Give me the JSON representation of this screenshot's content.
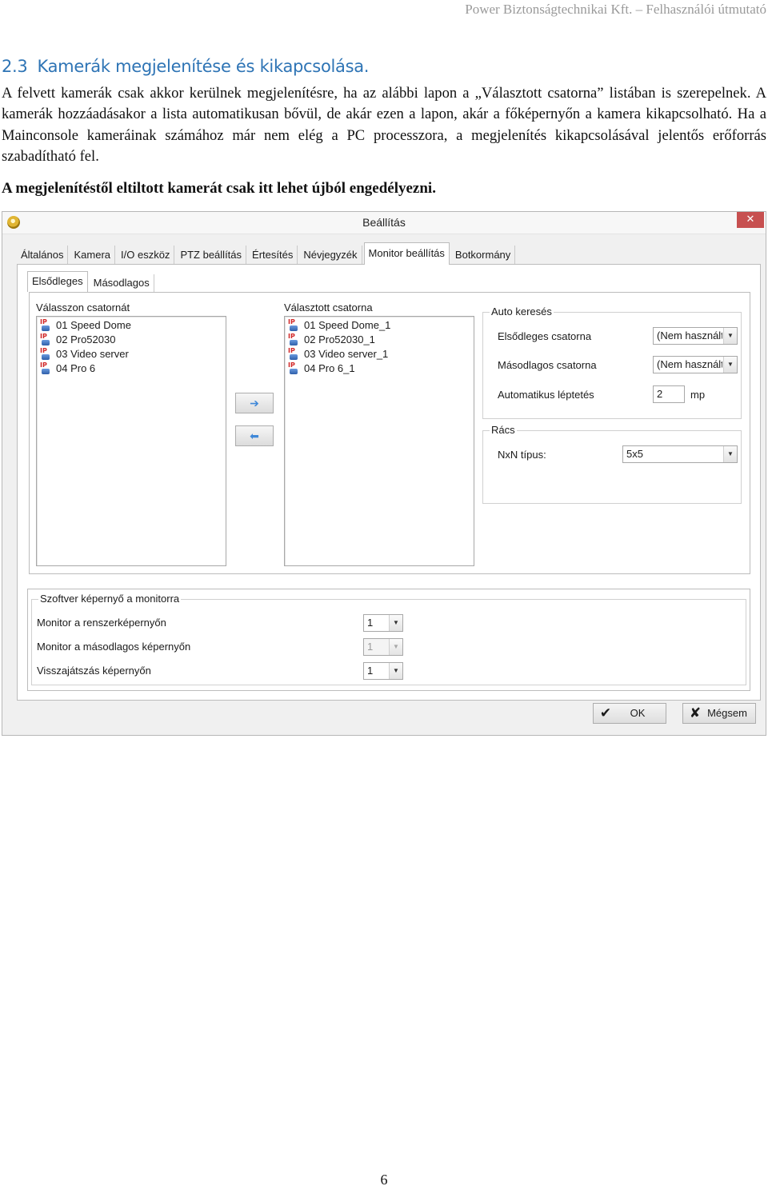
{
  "header": {
    "running_title": "Power Biztonságtechnikai Kft. – Felhasználói útmutató"
  },
  "section": {
    "number": "2.3",
    "title": "Kamerák megjelenítése és kikapcsolása.",
    "paragraph": "A felvett kamerák csak akkor kerülnek megjelenítésre, ha az alábbi lapon a „Választott csatorna” listában is szerepelnek. A kamerák hozzáadásakor a lista automatikusan bővül, de akár ezen a lapon, akár a főképernyőn a kamera kikapcsolható. Ha a Mainconsole kameráinak számához már nem elég a PC processzora, a megjelenítés kikapcsolásával jelentős erőforrás szabadítható fel.",
    "bold_note": "A megjelenítéstől eltiltott kamerát csak itt lehet újból engedélyezni."
  },
  "dialog": {
    "title": "Beállítás",
    "close_glyph": "✕",
    "tabs": [
      "Általános",
      "Kamera",
      "I/O eszköz",
      "PTZ beállítás",
      "Értesítés",
      "Névjegyzék",
      "Monitor beállítás",
      "Botkormány"
    ],
    "active_tab": "Monitor beállítás",
    "subtabs": [
      "Elsődleges",
      "Másodlagos"
    ],
    "active_subtab": "Elsődleges",
    "available_label": "Válasszon csatornát",
    "available_channels": [
      "01 Speed Dome",
      "02 Pro52030",
      "03 Video server",
      "04 Pro 6"
    ],
    "selected_label": "Választott csatorna",
    "selected_channels": [
      "01 Speed Dome_1",
      "02 Pro52030_1",
      "03 Video server_1",
      "04 Pro 6_1"
    ],
    "channel_icon_text": "IP",
    "add_button_glyph": "➔",
    "remove_button_glyph": "⬅",
    "auto_search": {
      "title": "Auto keresés",
      "primary_label": "Elsődleges csatorna",
      "primary_value": "(Nem használt)",
      "secondary_label": "Másodlagos csatorna",
      "secondary_value": "(Nem használt)",
      "auto_step_label": "Automatikus léptetés",
      "auto_step_value": "2",
      "auto_step_unit": "mp"
    },
    "grid": {
      "title": "Rács",
      "nxn_label": "NxN típus:",
      "nxn_value": "5x5"
    },
    "software_screen": {
      "title": "Szoftver képernyő a monitorra",
      "system_label": "Monitor a renszerképernyőn",
      "system_value": "1",
      "secondary_label": "Monitor a másodlagos képernyőn",
      "secondary_value": "1",
      "playback_label": "Visszajátszás képernyőn",
      "playback_value": "1"
    },
    "ok_label": "OK",
    "cancel_label": "Mégsem",
    "ok_glyph": "✔",
    "cancel_glyph": "✘"
  },
  "footer": {
    "page_number": "6"
  },
  "colors": {
    "heading_blue": "#2e74b5",
    "close_red": "#c75050",
    "ip_red": "#d12727"
  }
}
